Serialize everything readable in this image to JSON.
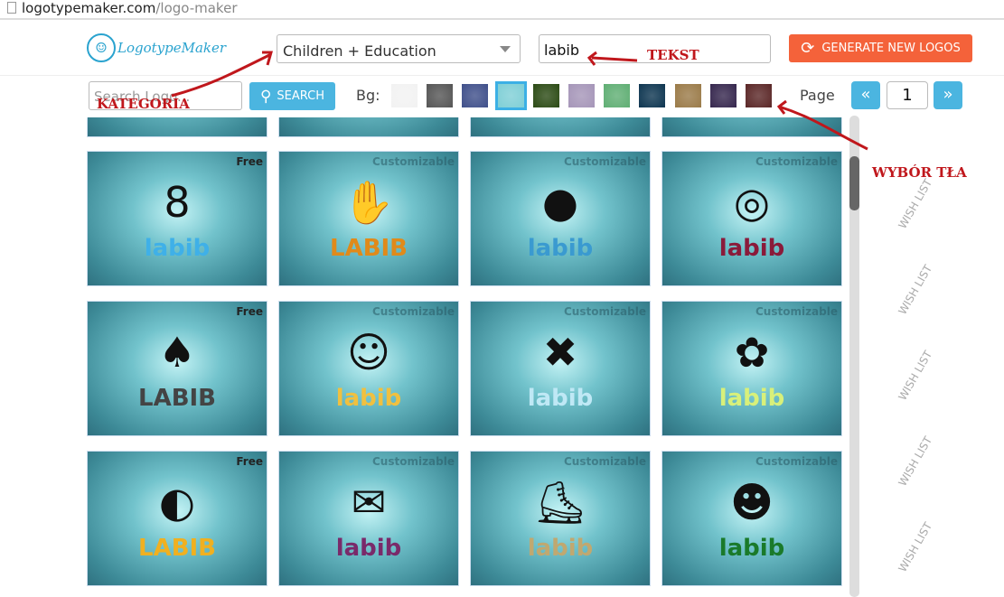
{
  "browser": {
    "domain": "logotypemaker.com",
    "path": "/logo-maker"
  },
  "header": {
    "logo_text": "LogotypeMaker",
    "category": "Children + Education",
    "text_value": "labib",
    "generate_label": "GENERATE NEW LOGOS"
  },
  "toolbar": {
    "search_placeholder": "Search Logo...",
    "search_label": "SEARCH",
    "bg_label": "Bg:",
    "page_label": "Page",
    "page": "1",
    "swatches": [
      "#f2f2f2",
      "#555555",
      "#3f4f8a",
      "#7fcfd6",
      "#2b4a14",
      "#a595b8",
      "#5fae73",
      "#0d3550",
      "#9a7a48",
      "#35264d",
      "#5a2626"
    ],
    "selected_swatch": 3
  },
  "cards": [
    {
      "tag": "Free",
      "symbol": "8",
      "word": "labib",
      "color": "#3fb0e8"
    },
    {
      "tag": "Customizable",
      "symbol": "✋",
      "word": "LABIB",
      "color": "#e08a1a"
    },
    {
      "tag": "Customizable",
      "symbol": "●",
      "word": "labib",
      "color": "#3a9ad0"
    },
    {
      "tag": "Customizable",
      "symbol": "◎",
      "word": "labib",
      "color": "#8a1a3a"
    },
    {
      "tag": "Free",
      "symbol": "♠",
      "word": "LABIB",
      "color": "#444444"
    },
    {
      "tag": "Customizable",
      "symbol": "☺",
      "word": "labib",
      "color": "#f0c040"
    },
    {
      "tag": "Customizable",
      "symbol": "✖",
      "word": "labib",
      "color": "#bfe8f5"
    },
    {
      "tag": "Customizable",
      "symbol": "✿",
      "word": "labib",
      "color": "#d8f07a"
    },
    {
      "tag": "Free",
      "symbol": "◐",
      "word": "LABIB",
      "color": "#f0b020"
    },
    {
      "tag": "Customizable",
      "symbol": "✉",
      "word": "labib",
      "color": "#7a2a6a"
    },
    {
      "tag": "Customizable",
      "symbol": "⛸",
      "word": "labib",
      "color": "#c0a870"
    },
    {
      "tag": "Customizable",
      "symbol": "☻",
      "word": "labib",
      "color": "#1a7a2a"
    }
  ],
  "wish_label": "WISH LIST",
  "annotations": {
    "category": "KATEGORIA",
    "text": "TEKST",
    "background": "WYBÓR TŁA"
  }
}
